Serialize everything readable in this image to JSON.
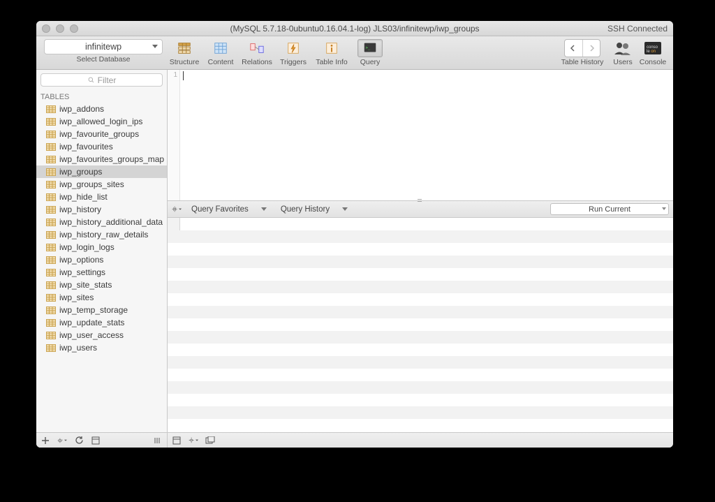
{
  "titlebar": {
    "title": "(MySQL 5.7.18-0ubuntu0.16.04.1-log) JLS03/infinitewp/iwp_groups",
    "ssh": "SSH Connected"
  },
  "toolbar": {
    "db_selected": "infinitewp",
    "select_db_label": "Select Database",
    "tabs": {
      "structure": "Structure",
      "content": "Content",
      "relations": "Relations",
      "triggers": "Triggers",
      "tableinfo": "Table Info",
      "query": "Query"
    },
    "right": {
      "tablehistory": "Table History",
      "users": "Users",
      "console": "Console"
    }
  },
  "sidebar": {
    "filter_placeholder": "Filter",
    "section": "TABLES",
    "tables": [
      "iwp_addons",
      "iwp_allowed_login_ips",
      "iwp_favourite_groups",
      "iwp_favourites",
      "iwp_favourites_groups_map",
      "iwp_groups",
      "iwp_groups_sites",
      "iwp_hide_list",
      "iwp_history",
      "iwp_history_additional_data",
      "iwp_history_raw_details",
      "iwp_login_logs",
      "iwp_options",
      "iwp_settings",
      "iwp_site_stats",
      "iwp_sites",
      "iwp_temp_storage",
      "iwp_update_stats",
      "iwp_user_access",
      "iwp_users"
    ],
    "selected": "iwp_groups"
  },
  "query": {
    "line": "1",
    "favorites": "Query Favorites",
    "history": "Query History",
    "run": "Run Current"
  }
}
